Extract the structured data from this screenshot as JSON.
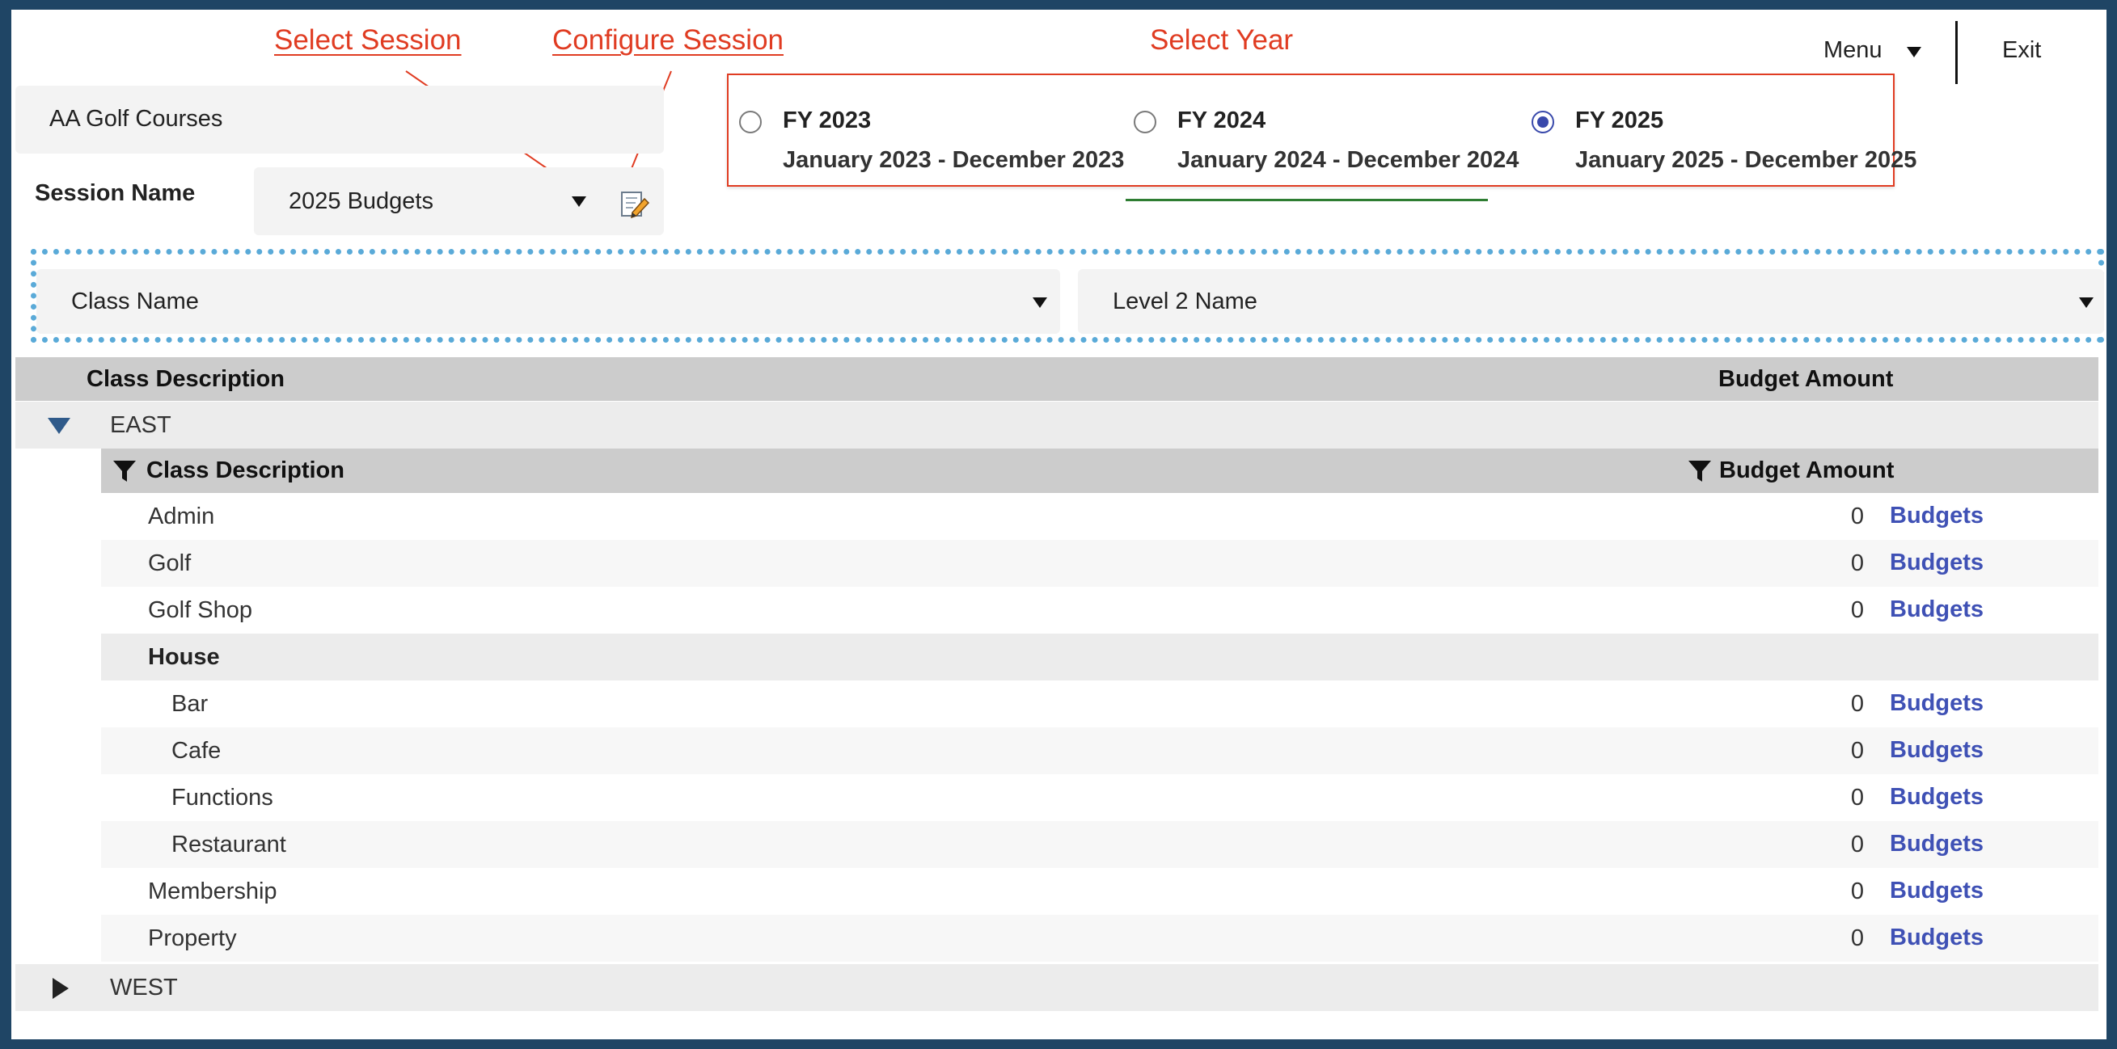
{
  "annotations": {
    "select_session": "Select Session",
    "configure_session": "Configure Session",
    "select_year": "Select Year"
  },
  "header": {
    "company": "AA Golf Courses",
    "session_label": "Session Name",
    "session_value": "2025 Budgets",
    "menu_label": "Menu",
    "exit_label": "Exit"
  },
  "years": [
    {
      "label": "FY 2023",
      "range": "January 2023 - December 2023",
      "selected": false
    },
    {
      "label": "FY 2024",
      "range": "January 2024 - December 2024",
      "selected": false
    },
    {
      "label": "FY 2025",
      "range": "January 2025 - December 2025",
      "selected": true
    }
  ],
  "filters": {
    "class_name": "Class Name",
    "level2_name": "Level 2 Name"
  },
  "grid": {
    "col_description": "Class Description",
    "col_amount": "Budget Amount",
    "groups": [
      {
        "name": "EAST",
        "expanded": true,
        "sub_col_description": "Class Description",
        "sub_col_amount": "Budget Amount",
        "rows": [
          {
            "label": "Admin",
            "amount": "0",
            "link": "Budgets"
          },
          {
            "label": "Golf",
            "amount": "0",
            "link": "Budgets"
          },
          {
            "label": "Golf Shop",
            "amount": "0",
            "link": "Budgets"
          },
          {
            "label": "House",
            "amount": "",
            "link": ""
          },
          {
            "label": "Bar",
            "amount": "0",
            "link": "Budgets"
          },
          {
            "label": "Cafe",
            "amount": "0",
            "link": "Budgets"
          },
          {
            "label": "Functions",
            "amount": "0",
            "link": "Budgets"
          },
          {
            "label": "Restaurant",
            "amount": "0",
            "link": "Budgets"
          },
          {
            "label": "Membership",
            "amount": "0",
            "link": "Budgets"
          },
          {
            "label": "Property",
            "amount": "0",
            "link": "Budgets"
          }
        ]
      },
      {
        "name": "WEST",
        "expanded": false
      }
    ]
  },
  "colors": {
    "frame": "#1f4565",
    "annotation": "#e03c22",
    "accent": "#3949ab",
    "link": "#3f51b5",
    "filter_outline": "#5aaad8",
    "year_underline": "#2e7d32"
  }
}
